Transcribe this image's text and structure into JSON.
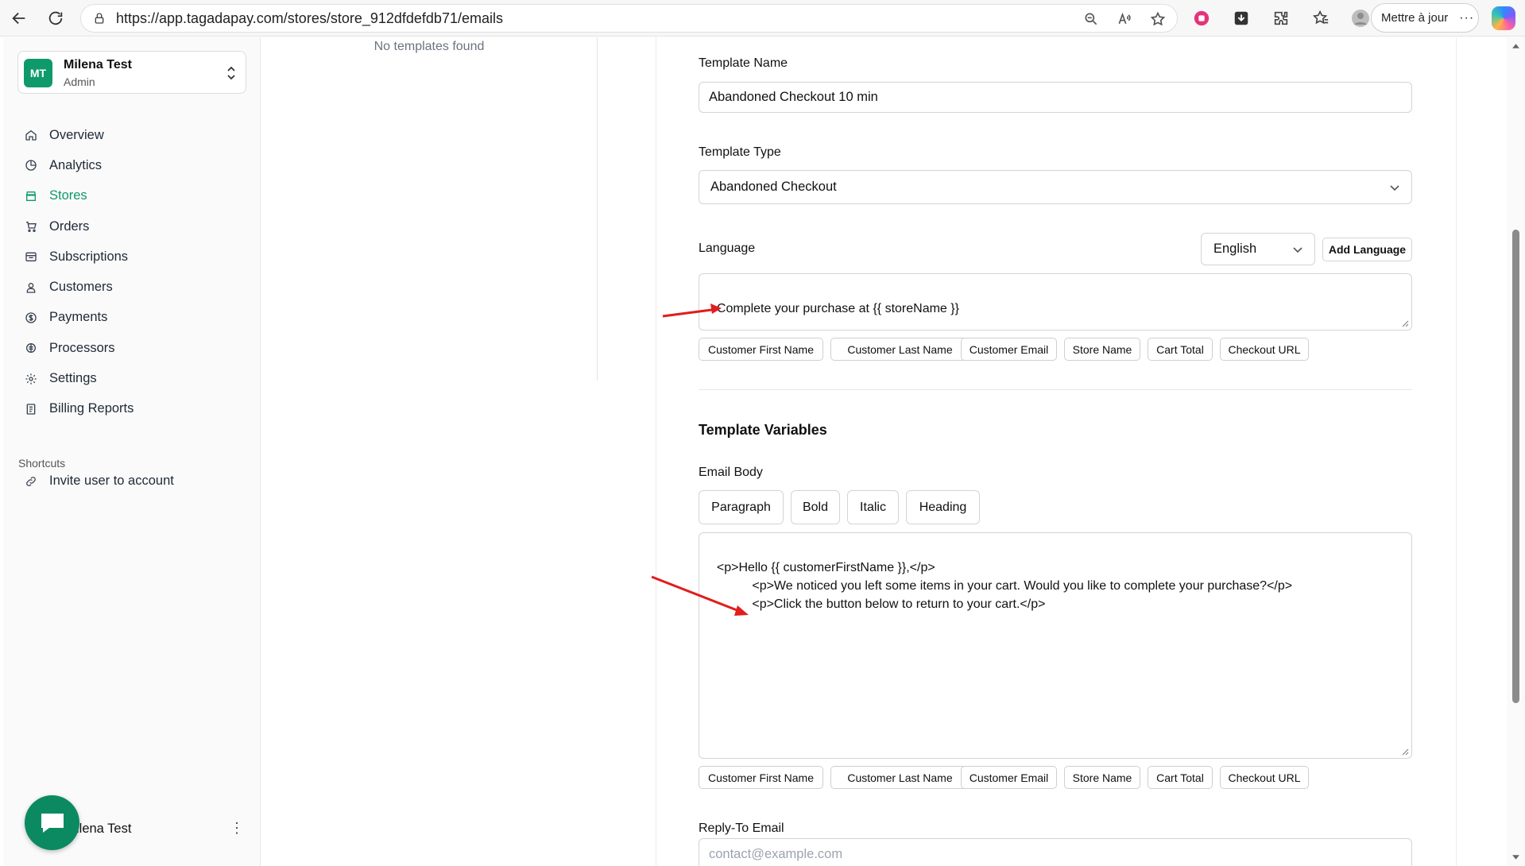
{
  "browser": {
    "url": "https://app.tagadapay.com/stores/store_912dfdefdb71/emails",
    "update_label": "Mettre à jour",
    "more_label": "···"
  },
  "sidebar": {
    "account": {
      "initials": "MT",
      "name": "Milena Test",
      "role": "Admin"
    },
    "nav": [
      {
        "label": "Overview",
        "icon": "home-icon"
      },
      {
        "label": "Analytics",
        "icon": "pie-chart-icon"
      },
      {
        "label": "Stores",
        "icon": "store-icon",
        "active": true
      },
      {
        "label": "Orders",
        "icon": "cart-icon"
      },
      {
        "label": "Subscriptions",
        "icon": "calendar-icon"
      },
      {
        "label": "Customers",
        "icon": "user-icon"
      },
      {
        "label": "Payments",
        "icon": "dollar-icon"
      },
      {
        "label": "Processors",
        "icon": "processor-icon"
      },
      {
        "label": "Settings",
        "icon": "gear-icon"
      },
      {
        "label": "Billing Reports",
        "icon": "report-icon"
      }
    ],
    "shortcuts_title": "Shortcuts",
    "shortcut_invite": "Invite user to account",
    "footer_user": "ilena Test"
  },
  "list": {
    "empty_text": "No templates found"
  },
  "editor": {
    "template_name_label": "Template Name",
    "template_name_value": "Abandoned Checkout 10 min",
    "template_type_label": "Template Type",
    "template_type_value": "Abandoned Checkout",
    "language_label": "Language",
    "language_value": "English",
    "add_language_label": "Add Language",
    "subject_value": "Complete your purchase at {{ storeName }}",
    "variable_chips": [
      "Customer First Name",
      "Customer Last Name",
      "Customer Email",
      "Store Name",
      "Cart Total",
      "Checkout URL"
    ],
    "section_title": "Template Variables",
    "email_body_label": "Email Body",
    "format_buttons": [
      "Paragraph",
      "Bold",
      "Italic",
      "Heading"
    ],
    "email_body_value": "<p>Hello {{ customerFirstName }},</p>\n            <p>We noticed you left some items in your cart. Would you like to complete your purchase?</p>\n            <p>Click the button below to return to your cart.</p>",
    "reply_to_label": "Reply-To Email",
    "reply_to_placeholder": "contact@example.com"
  },
  "colors": {
    "brand_green": "#0f9a6b",
    "annotation_red": "#e11d1d"
  }
}
